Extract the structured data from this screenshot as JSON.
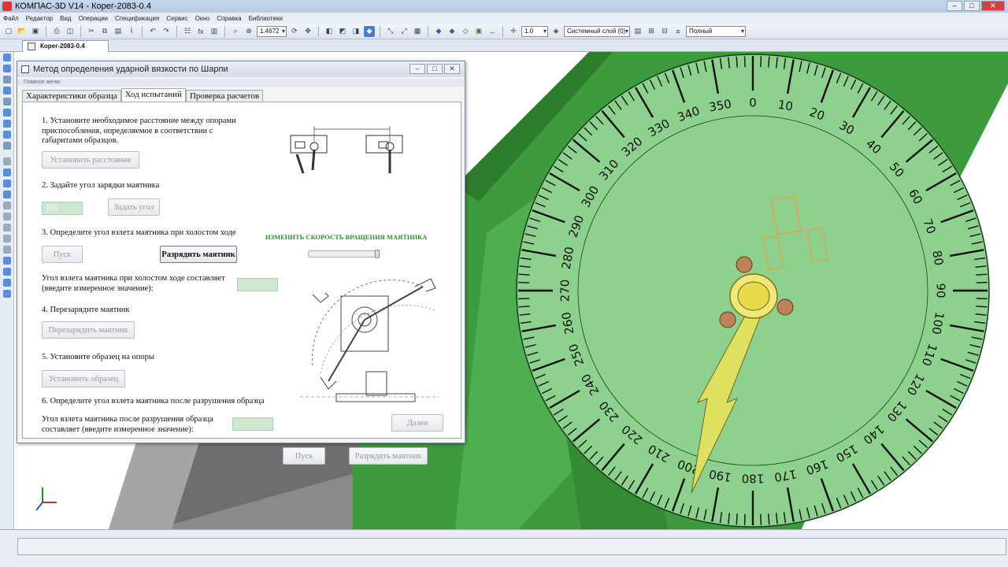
{
  "app": {
    "title": "КОМПАС-3D V14 - Корег-2083-0.4"
  },
  "menu": [
    "Файл",
    "Редактор",
    "Вид",
    "Операции",
    "Спецификация",
    "Сервис",
    "Окно",
    "Справка",
    "Библиотеки"
  ],
  "toolbar": {
    "zoom_value": "1.4672",
    "step_value": "1.0",
    "layer_value": "Системный слой (0)",
    "view_mode": "Полный"
  },
  "doc_tab": "Корег-2083-0.4",
  "dialog": {
    "title": "Метод определения ударной вязкости по Шарпи",
    "main_menu": "Главное меню",
    "tabs": [
      "Характеристики образца",
      "Ход испытаний",
      "Проверка  расчетов"
    ],
    "step1": "1. Установите необходимое расстояние между опорами приспособления, определяемое в соответствии с габаритами образцов.",
    "btn_set_distance": "Установить расстояние",
    "step2": "2. Задайте угол зарядки маятника",
    "angle_value": "165",
    "btn_set_angle": "Задать угол",
    "step3": "3. Определите угол взлета маятника при холостом ходе",
    "btn_start": "Пуск",
    "btn_discharge": "Разрядить маятник",
    "idle_angle_label": "Угол взлета маятника при холостом ходе составляет (введите измеренное значение):",
    "step4": "4. Перезарядите маятник",
    "btn_recharge": "Перезарядить маятник",
    "step5": "5. Установите образец на опоры",
    "btn_set_sample": "Установить образец",
    "step6": "6. Определите угол взлета маятника после разрушения образца",
    "break_angle_label": "Угол взлета маятника после разрушения образца составляет (введите измеренное значение):",
    "speed_label": "ИЗМЕНИТЬ СКОРОСТЬ ВРАЩЕНИЯ МАЯТНИКА",
    "btn_start2": "Пуск",
    "btn_discharge2": "Разрядить маятник",
    "btn_next": "Далее"
  },
  "dial": {
    "labels": [
      "0",
      "10",
      "20",
      "30",
      "40",
      "50",
      "60",
      "70",
      "80",
      "90",
      "100",
      "110",
      "120",
      "130",
      "140",
      "150",
      "160",
      "170",
      "180",
      "190",
      "200",
      "210",
      "220",
      "230",
      "240",
      "250",
      "260",
      "270",
      "280",
      "290",
      "300",
      "310",
      "320",
      "330",
      "340",
      "350"
    ],
    "pointer_angle_deg": 205,
    "colors": {
      "dial": "#8ed08e",
      "frame": "#3d9a3d",
      "needle": "#e0e060"
    }
  }
}
